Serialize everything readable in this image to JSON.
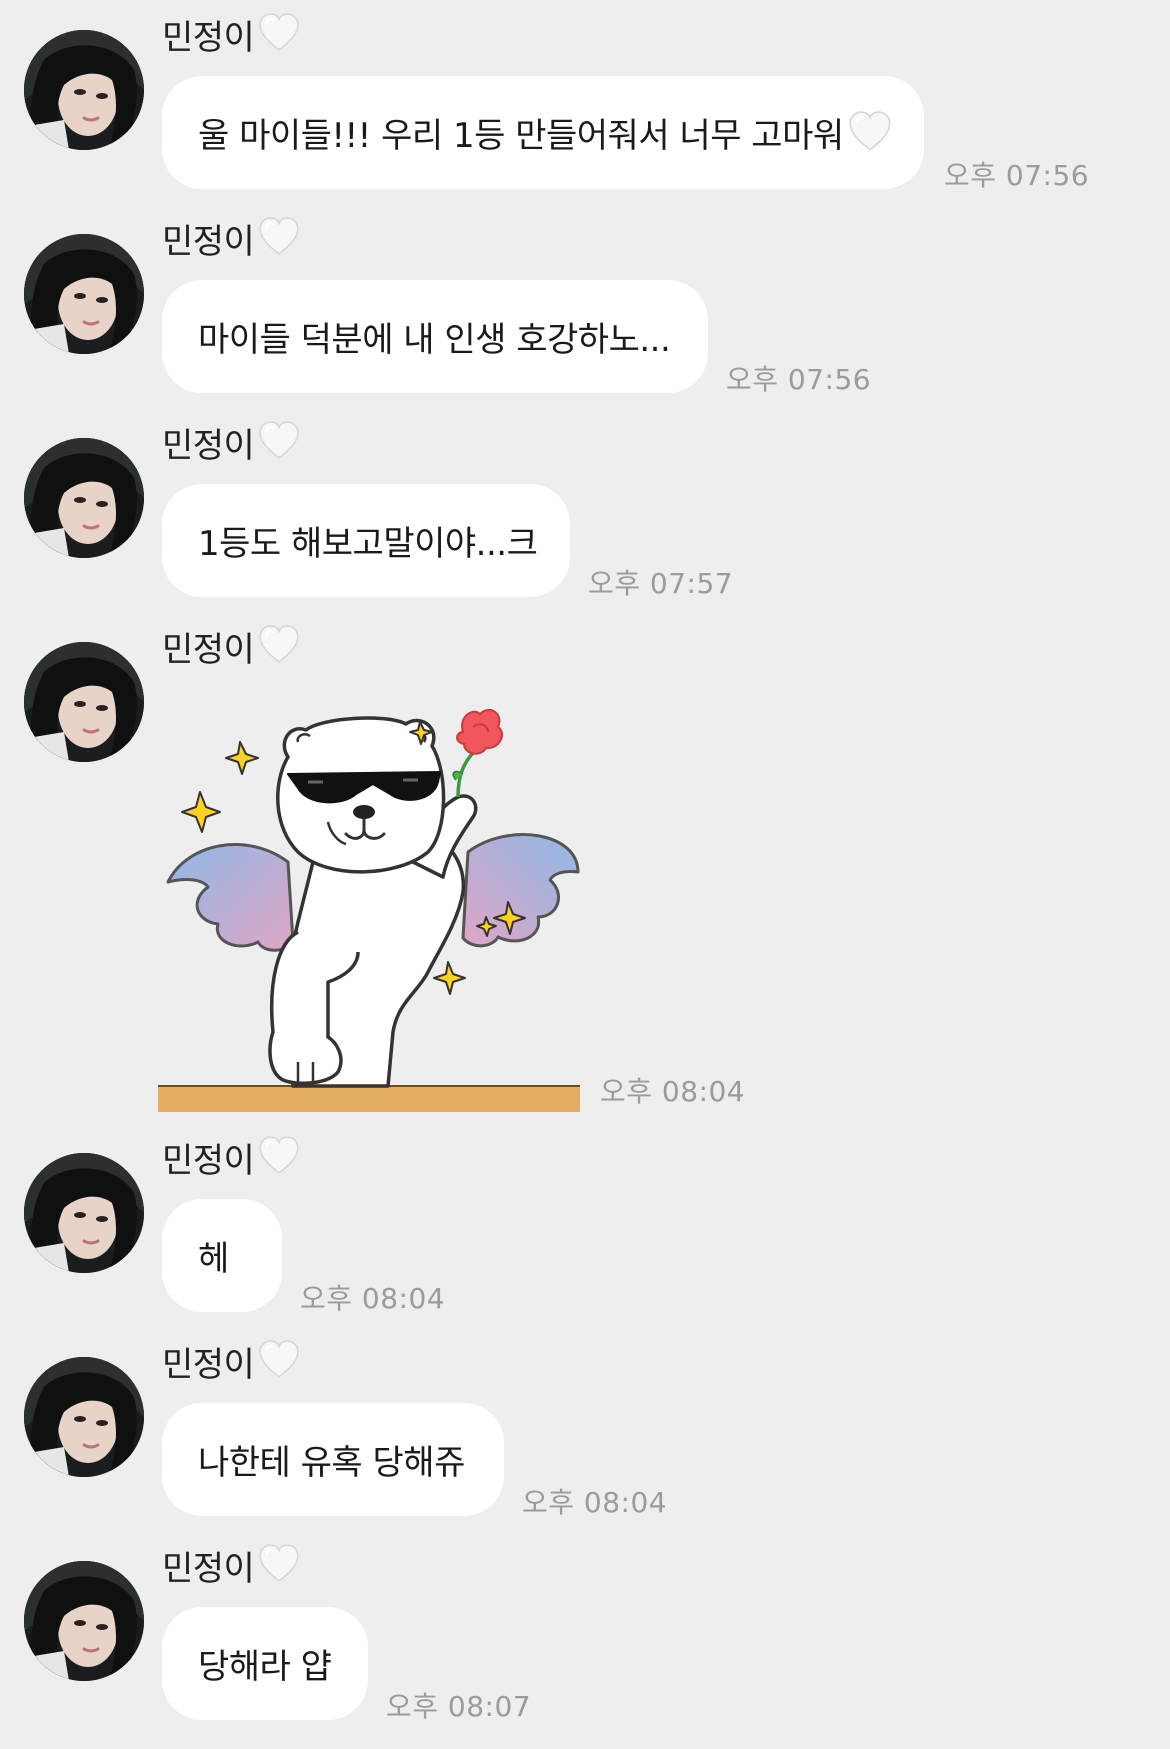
{
  "sender": {
    "name": "민정이",
    "name_emoji": "white-heart-icon"
  },
  "messages": [
    {
      "type": "text",
      "text": "울 마이들!!! 우리 1등 만들어줘서 너무 고마워",
      "trailing_emoji": "white-heart-icon",
      "time": "오후 07:56"
    },
    {
      "type": "text",
      "text": "마이들 덕분에 내 인생 호강하노...",
      "time": "오후 07:56"
    },
    {
      "type": "text",
      "text": "1등도 해보고말이야...크",
      "time": "오후 07:57"
    },
    {
      "type": "sticker",
      "sticker": "bear-angel-sunglasses-rose-sticker",
      "time": "오후 08:04"
    },
    {
      "type": "text",
      "text": "헤",
      "time": "오후 08:04"
    },
    {
      "type": "text",
      "text": "나한테 유혹 당해쥬",
      "time": "오후 08:04"
    },
    {
      "type": "text",
      "text": "당해라 얍",
      "time": "오후 08:07"
    }
  ],
  "colors": {
    "background": "#eeeeee",
    "bubble": "#ffffff",
    "timestamp": "#9b9b9b",
    "name_text": "#222222"
  }
}
